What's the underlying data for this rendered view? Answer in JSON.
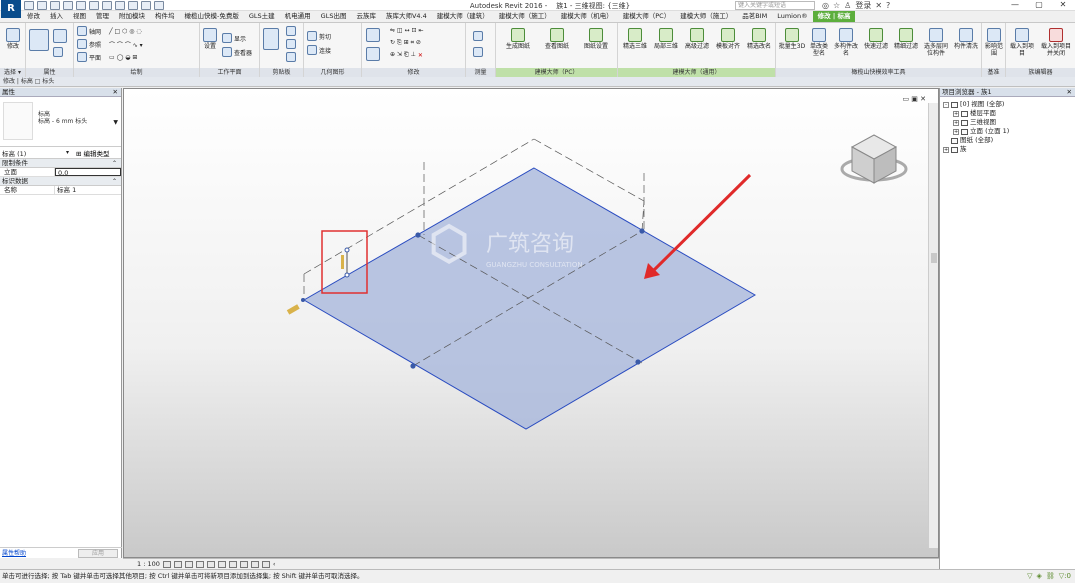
{
  "app": {
    "title": "Autodesk Revit 2016 -",
    "doc_title": "族1 - 三维视图: {三维}",
    "app_button": "R",
    "search_placeholder": "键入关键字或短语",
    "login": "登录",
    "help": "?"
  },
  "tabs": [
    "修改",
    "插入",
    "视图",
    "管理",
    "附加模块",
    "构件坞",
    "橄榄山快模-免费版",
    "GLS土建",
    "机电通用",
    "GLS出图",
    "云族库",
    "族库大师V4.4",
    "建模大师（建筑）",
    "建模大师（施工）",
    "建模大师（机电）",
    "建模大师（PC）",
    "建模大师（施工）",
    "品茗BIM",
    "Lumion®",
    "修改 | 标高"
  ],
  "active_tab_index": 19,
  "ribbon": {
    "select_label": "修改",
    "groups": [
      {
        "label": "选择 ▾"
      },
      {
        "label": "属性"
      },
      {
        "label": "绘制"
      },
      {
        "label": "工作平面"
      },
      {
        "label": "剪贴板"
      },
      {
        "label": "几何图形"
      },
      {
        "label": "修改"
      },
      {
        "label": "测量"
      },
      {
        "label": "建模大师（PC）"
      },
      {
        "label": "建模大师（通用）"
      },
      {
        "label": "橄榄山快模效率工具"
      },
      {
        "label": "基准"
      },
      {
        "label": "族编辑器"
      }
    ],
    "draw_items": {
      "pick_line": "轴网",
      "ref_plane": "参照",
      "plane": "平面"
    },
    "workplane_items": {
      "set": "设置",
      "show": "显示",
      "viewer": "查看器"
    },
    "geometry_items": {
      "cut": "剪切",
      "join": "连接"
    },
    "pc_buttons": [
      "生成图纸",
      "查看图纸",
      "图纸设置"
    ],
    "general_buttons": [
      "精选三维",
      "局部三维",
      "高级过滤",
      "模板对齐",
      "精选改名"
    ],
    "glsm_buttons": [
      "批量生3D",
      "单改类型名",
      "多构件改名",
      "快速过滤",
      "精细过滤",
      "选多层同位构件",
      "构件清洗"
    ],
    "datum_buttons": [
      "影响范围"
    ],
    "family_buttons": [
      "载入到项目",
      "载入到项目并关闭"
    ]
  },
  "context_bar": "修改 | 标高   □ 标头",
  "properties": {
    "title": "属性",
    "type_name_line1": "标高",
    "type_name_line2": "标高 - 6 mm 标头",
    "instance_selector": "标高 (1)",
    "edit_type": "编辑类型",
    "sections": [
      {
        "name": "限制条件",
        "rows": [
          {
            "key": "立面",
            "value": "0.0"
          }
        ]
      },
      {
        "name": "标识数据",
        "rows": [
          {
            "key": "名称",
            "value": "标高 1"
          }
        ]
      }
    ],
    "help_link": "属性帮助",
    "apply": "应用"
  },
  "viewport": {
    "watermark_title": "广筑咨询",
    "watermark_sub": "GUANGZHU CONSULTATION",
    "colors": {
      "floor_fill": "#a9b8dc",
      "floor_stroke": "#2a4cc0",
      "highlight": "#e03030",
      "arrow": "#e02a2a",
      "level_tag": "#d9b24a"
    }
  },
  "view_bar": {
    "scale": "1 : 100"
  },
  "browser": {
    "title": "项目浏览器 - 族1",
    "tree": [
      {
        "level": 0,
        "toggle": "-",
        "label": "[0] 视图 (全部)"
      },
      {
        "level": 1,
        "toggle": "+",
        "label": "楼层平面"
      },
      {
        "level": 1,
        "toggle": "+",
        "label": "三维视图"
      },
      {
        "level": 1,
        "toggle": "+",
        "label": "立面 (立面 1)"
      },
      {
        "level": 0,
        "toggle": "",
        "label": "图纸 (全部)"
      },
      {
        "level": 0,
        "toggle": "+",
        "label": "族"
      }
    ]
  },
  "status": {
    "text": "单击可进行选择; 按 Tab 键并单击可选择其他项目; 按 Ctrl 键并单击可将新项目添加到选择集; 按 Shift 键并单击可取消选择。",
    "icons": [
      "filter-icon",
      "selection-icon",
      "link-icon"
    ]
  }
}
